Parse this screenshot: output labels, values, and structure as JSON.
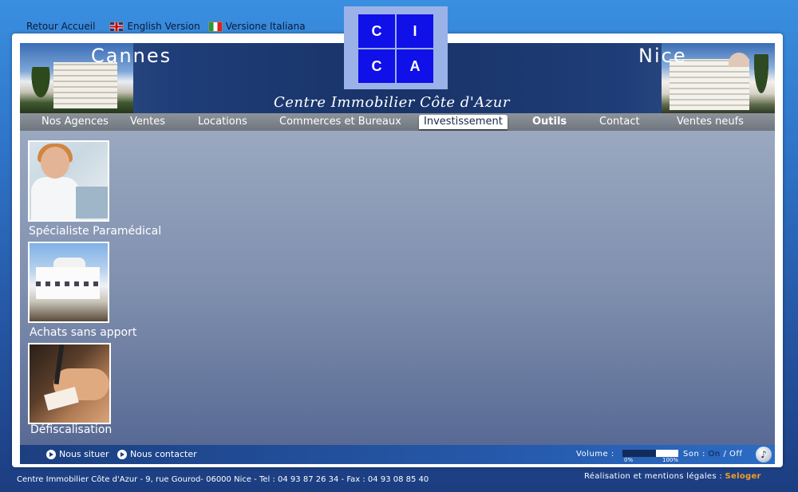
{
  "top_links": {
    "home": "Retour Accueil",
    "english": "English Version",
    "italian": "Versione Italiana"
  },
  "banner": {
    "city_left": "Cannes",
    "city_right": "Nice",
    "tagline": "Centre Immobilier Côte d'Azur"
  },
  "logo": {
    "letters": [
      "C",
      "I",
      "C",
      "A"
    ],
    "color": "#1010e8"
  },
  "nav": {
    "items": [
      {
        "label": "Nos Agences"
      },
      {
        "label": "Ventes"
      },
      {
        "label": "Locations"
      },
      {
        "label": "Commerces et Bureaux"
      },
      {
        "label": "Investissement",
        "active": true
      },
      {
        "label": "Outils"
      },
      {
        "label": "Contact"
      },
      {
        "label": "Ventes neufs"
      }
    ]
  },
  "cards": [
    {
      "label": "Spécialiste Paramédical",
      "icon": "nurse-photo"
    },
    {
      "label": "Achats sans apport",
      "icon": "building-photo"
    },
    {
      "label": "Défiscalisation",
      "icon": "signing-photo"
    }
  ],
  "footer_bar": {
    "situate": "Nous situer",
    "contact": "Nous contacter",
    "volume_label": "Volume :",
    "volume_min": "0%",
    "volume_max": "100%",
    "volume_level": 0.6,
    "sound_label": "Son :",
    "sound_on": "On",
    "sound_sep": "/",
    "sound_off": "Off"
  },
  "footer": {
    "address": "Centre Immobilier Côte d'Azur - 9, rue Gourod- 06000 Nice - Tel : 04 93 87 26 34 - Fax : 04 93 08 85 40",
    "credits_prefix": "Réalisation et mentions légales :",
    "credits_brand": "Seloger"
  }
}
